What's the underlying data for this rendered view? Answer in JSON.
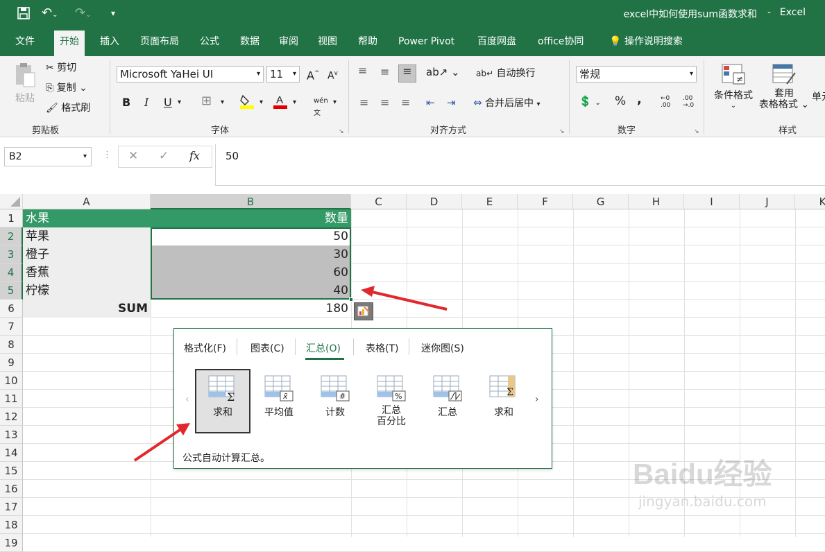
{
  "titlebar": {
    "title": "excel中如何使用sum函数求和",
    "app": "Excel"
  },
  "tabs": [
    "文件",
    "开始",
    "插入",
    "页面布局",
    "公式",
    "数据",
    "审阅",
    "视图",
    "帮助",
    "Power Pivot",
    "百度网盘",
    "office协同"
  ],
  "tell_me": "操作说明搜索",
  "ribbon": {
    "clipboard": {
      "paste": "粘贴",
      "cut": "剪切",
      "copy": "复制",
      "format_painter": "格式刷",
      "label": "剪贴板"
    },
    "font": {
      "name": "Microsoft YaHei UI",
      "size": "11",
      "bold": "B",
      "italic": "I",
      "underline": "U",
      "label": "字体",
      "grow": "A",
      "shrink": "A",
      "phonetic": "wén"
    },
    "alignment": {
      "wrap": "自动换行",
      "merge": "合并后居中",
      "label": "对齐方式"
    },
    "number": {
      "format": "常规",
      "percent": "%",
      "comma": ",",
      "label": "数字"
    },
    "styles": {
      "conditional": "条件格式",
      "table1": "套用",
      "table2": "表格格式",
      "cell": "单元",
      "label": "样式"
    }
  },
  "formula_bar": {
    "name_box": "B2",
    "cancel": "✕",
    "enter": "✓",
    "fx": "fx",
    "value": "50"
  },
  "columns": [
    "A",
    "B",
    "C",
    "D",
    "E",
    "F",
    "G",
    "H",
    "I",
    "J",
    "K"
  ],
  "rows": [
    "1",
    "2",
    "3",
    "4",
    "5",
    "6",
    "7",
    "8",
    "9",
    "10",
    "11",
    "12",
    "13",
    "14",
    "15",
    "16",
    "17",
    "18",
    "19"
  ],
  "cells": {
    "a1": "水果",
    "b1": "数量",
    "a2": "苹果",
    "b2": "50",
    "a3": "橙子",
    "b3": "30",
    "a4": "香蕉",
    "b4": "60",
    "a5": "柠檬",
    "b5": "40",
    "a6": "SUM",
    "b6": "180"
  },
  "quick_analysis": {
    "tabs": [
      "格式化(F)",
      "图表(C)",
      "汇总(O)",
      "表格(T)",
      "迷你图(S)"
    ],
    "items": [
      {
        "label": "求和",
        "icon": "sum-icon"
      },
      {
        "label": "平均值",
        "icon": "average-icon"
      },
      {
        "label": "计数",
        "icon": "count-icon"
      },
      {
        "label": "汇总",
        "label2": "百分比",
        "icon": "percent-icon"
      },
      {
        "label": "汇总",
        "icon": "running-total-icon"
      },
      {
        "label": "求和",
        "icon": "sum-column-icon"
      }
    ],
    "description": "公式自动计算汇总。",
    "prev": "‹",
    "next": "›"
  },
  "watermark": {
    "brand": "Baidu经验",
    "url": "jingyan.baidu.com"
  },
  "colors": {
    "accent": "#217346",
    "header_fill": "#339966",
    "arrow": "#e0282d"
  }
}
